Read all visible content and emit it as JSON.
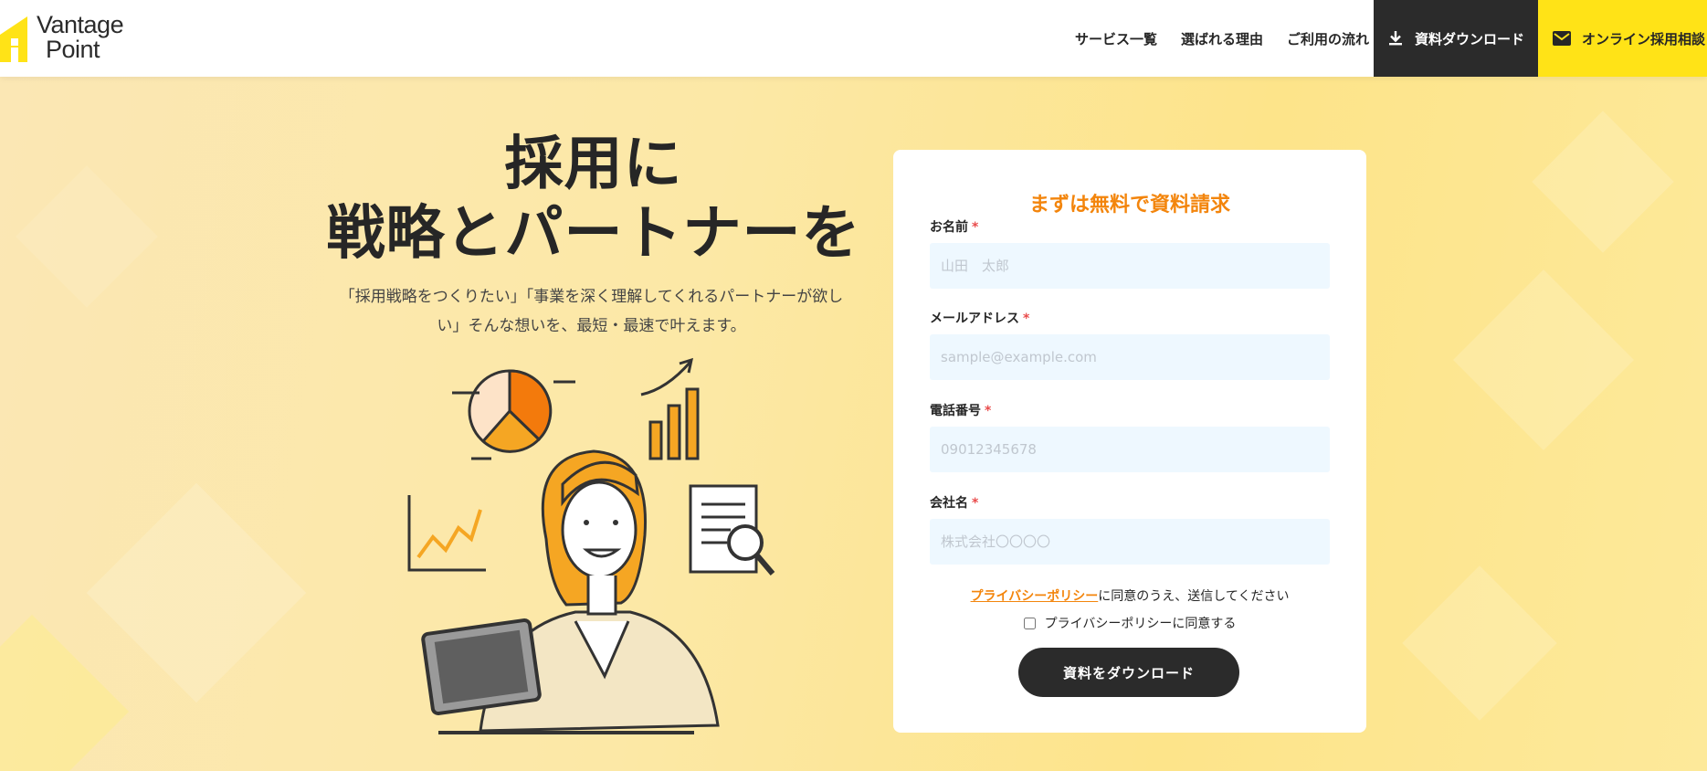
{
  "brand": {
    "logo_line1": "Vantage",
    "logo_line2": "Point",
    "accent": "#ffe317",
    "orange": "#f3850c"
  },
  "nav": {
    "items": [
      "サービス一覧",
      "選ばれる理由",
      "ご利用の流れ"
    ],
    "download_label": "資料ダウンロード",
    "online_label": "オンライン採用相談"
  },
  "hero": {
    "title_line1": "採用に",
    "title_line2": "戦略とパートナーを",
    "lead": "「採用戦略をつくりたい」「事業を深く理解してくれるパートナーが欲しい」そんな想いを、最短・最速で叶えます。"
  },
  "form": {
    "title": "まずは無料で資料請求",
    "required_mark": "*",
    "fields": [
      {
        "label": "お名前",
        "placeholder": "山田　太郎"
      },
      {
        "label": "メールアドレス",
        "placeholder": "sample@example.com"
      },
      {
        "label": "電話番号",
        "placeholder": "09012345678"
      },
      {
        "label": "会社名",
        "placeholder": "株式会社〇〇〇〇"
      }
    ],
    "privacy_link": "プライバシーポリシー",
    "privacy_suffix": "に同意のうえ、送信してください",
    "agree_label": "プライバシーポリシーに同意する",
    "submit_label": "資料をダウンロード"
  }
}
